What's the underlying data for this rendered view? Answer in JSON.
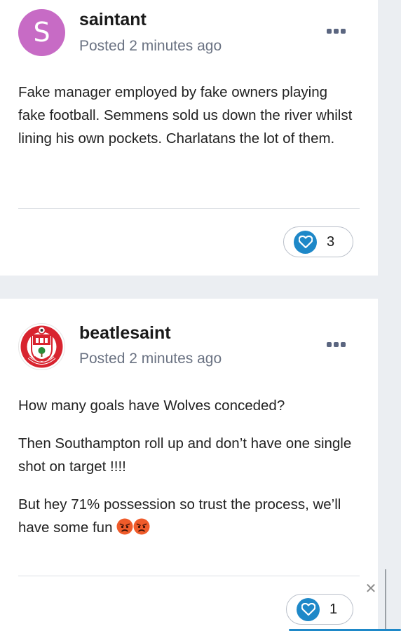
{
  "posts": [
    {
      "avatar_letter": "S",
      "avatar_color": "#c76bc5",
      "username": "saintant",
      "meta": "Posted 2 minutes ago",
      "paragraphs": [
        "Fake manager employed by fake owners playing fake football. Semmens sold us down the river whilst lining his own pockets. Charlatans the lot of them."
      ],
      "reaction_icon": "heart-icon",
      "reaction_count": "3"
    },
    {
      "avatar_icon": "club-crest-icon",
      "username": "beatlesaint",
      "meta": "Posted 2 minutes ago",
      "paragraphs": [
        "How many goals have Wolves conceded?",
        "Then Southampton roll up and don’t have one single shot on target !!!!",
        "But hey 71% possession so trust the process, we’ll have some fun"
      ],
      "emojis": [
        "angry-face-emoji",
        "angry-face-emoji"
      ],
      "reaction_icon": "heart-icon",
      "reaction_count": "1"
    }
  ],
  "colors": {
    "accent": "#1e88c8",
    "meta_text": "#6a7282",
    "background": "#ebeef2"
  },
  "close_label": "✕"
}
